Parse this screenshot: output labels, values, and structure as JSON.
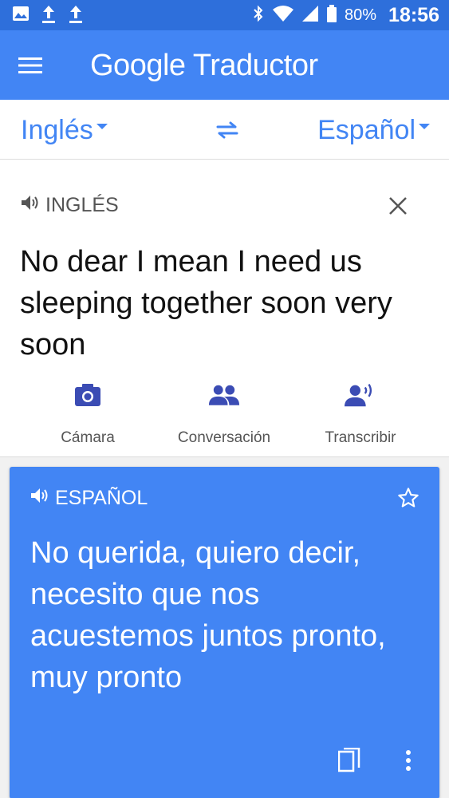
{
  "status_bar": {
    "left_icons": [
      "image-icon",
      "upload-icon",
      "upload-icon"
    ],
    "right_icons": [
      "bluetooth-icon",
      "wifi-icon",
      "signal-icon",
      "battery-icon"
    ],
    "battery": "80%",
    "time": "18:56"
  },
  "app_bar": {
    "title": "Google Traductor",
    "menu_icon": "menu-icon"
  },
  "languages": {
    "source": "Inglés",
    "target": "Español",
    "swap_icon": "swap-icon"
  },
  "source": {
    "label": "INGLÉS",
    "text": "No dear I mean I need us sleeping together soon very soon"
  },
  "tools": [
    {
      "label": "Cámara",
      "icon": "camera-icon"
    },
    {
      "label": "Conversación",
      "icon": "conversation-icon"
    },
    {
      "label": "Transcribir",
      "icon": "transcribe-icon"
    }
  ],
  "result": {
    "label": "ESPAÑOL",
    "text": "No querida, quiero decir, necesito que nos acuestemos juntos pronto, muy pronto"
  },
  "colors": {
    "status_bar": "#2e6fdb",
    "app_bar": "#4285f4",
    "accent": "#4285f4",
    "tool_icon": "#3b4cb4",
    "result_card": "#4285f4"
  }
}
